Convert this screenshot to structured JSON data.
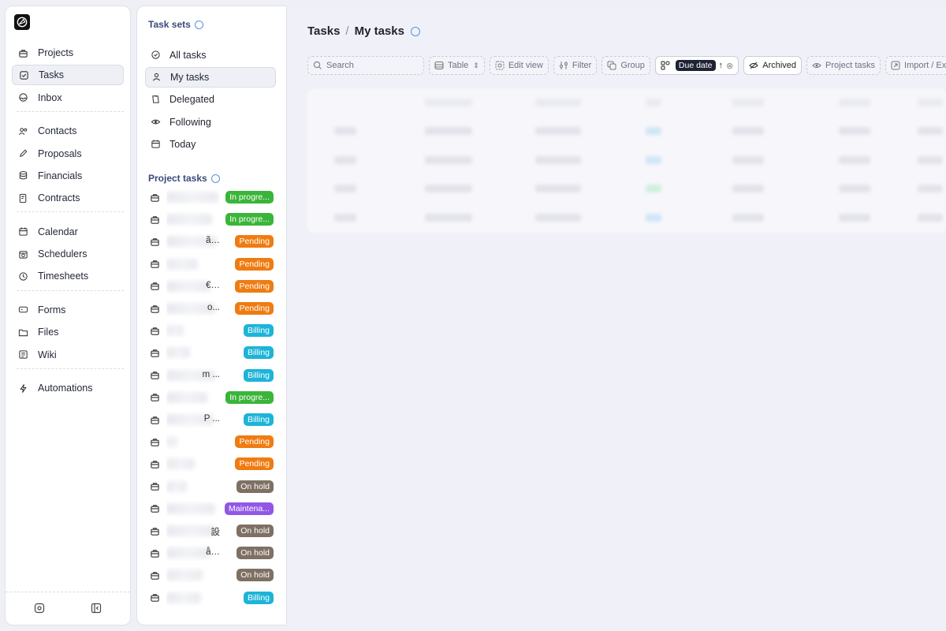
{
  "sidebar": {
    "groups": [
      [
        {
          "label": "Projects",
          "icon": "briefcase-icon"
        },
        {
          "label": "Tasks",
          "icon": "checkbox-icon",
          "active": true
        },
        {
          "label": "Inbox",
          "icon": "inbox-icon"
        }
      ],
      [
        {
          "label": "Contacts",
          "icon": "users-icon"
        },
        {
          "label": "Proposals",
          "icon": "pen-icon"
        },
        {
          "label": "Financials",
          "icon": "database-icon"
        },
        {
          "label": "Contracts",
          "icon": "contract-icon"
        }
      ],
      [
        {
          "label": "Calendar",
          "icon": "calendar-icon"
        },
        {
          "label": "Schedulers",
          "icon": "scheduler-icon"
        },
        {
          "label": "Timesheets",
          "icon": "clock-icon"
        }
      ],
      [
        {
          "label": "Forms",
          "icon": "form-icon"
        },
        {
          "label": "Files",
          "icon": "folder-icon"
        },
        {
          "label": "Wiki",
          "icon": "book-icon"
        }
      ],
      [
        {
          "label": "Automations",
          "icon": "bolt-icon"
        }
      ]
    ]
  },
  "panel": {
    "task_sets_title": "Task sets",
    "task_sets": [
      {
        "label": "All tasks",
        "icon": "check-circle-icon"
      },
      {
        "label": "My tasks",
        "icon": "user-icon",
        "active": true
      },
      {
        "label": "Delegated",
        "icon": "delegate-icon"
      },
      {
        "label": "Following",
        "icon": "eye-icon"
      },
      {
        "label": "Today",
        "icon": "calendar-icon"
      }
    ],
    "project_tasks_title": "Project tasks",
    "project_tasks": [
      {
        "tail": "",
        "status": "In progre...",
        "color": "green"
      },
      {
        "tail": "",
        "status": "In progre...",
        "color": "green"
      },
      {
        "tail": "ã…",
        "status": "Pending",
        "color": "orange"
      },
      {
        "tail": "",
        "status": "Pending",
        "color": "orange"
      },
      {
        "tail": "€…",
        "status": "Pending",
        "color": "orange"
      },
      {
        "tail": "o...",
        "status": "Pending",
        "color": "orange"
      },
      {
        "tail": "",
        "status": "Billing",
        "color": "cyan"
      },
      {
        "tail": "",
        "status": "Billing",
        "color": "cyan"
      },
      {
        "tail": "m ...",
        "status": "Billing",
        "color": "cyan"
      },
      {
        "tail": "",
        "status": "In progre...",
        "color": "green"
      },
      {
        "tail": "P ...",
        "status": "Billing",
        "color": "cyan"
      },
      {
        "tail": "",
        "status": "Pending",
        "color": "orange"
      },
      {
        "tail": "",
        "status": "Pending",
        "color": "orange"
      },
      {
        "tail": "",
        "status": "On hold",
        "color": "brown"
      },
      {
        "tail": "",
        "status": "Maintena...",
        "color": "purple"
      },
      {
        "tail": "設",
        "status": "On hold",
        "color": "brown"
      },
      {
        "tail": "å…",
        "status": "On hold",
        "color": "brown"
      },
      {
        "tail": "",
        "status": "On hold",
        "color": "brown"
      },
      {
        "tail": "",
        "status": "Billing",
        "color": "cyan"
      }
    ]
  },
  "main": {
    "breadcrumb_root": "Tasks",
    "breadcrumb_sep": "/",
    "breadcrumb_current": "My tasks",
    "toolbar": {
      "search_placeholder": "Search",
      "view": "Table",
      "edit_view": "Edit view",
      "filter": "Filter",
      "group": "Group",
      "sort_field": "Due date",
      "archived": "Archived",
      "project_tasks": "Project tasks",
      "import_export": "Import / Export"
    }
  },
  "colors": {
    "green": "#3ab53a",
    "orange": "#ef7c12",
    "cyan": "#1cb4d8",
    "brown": "#7e7063",
    "purple": "#9257e6"
  }
}
